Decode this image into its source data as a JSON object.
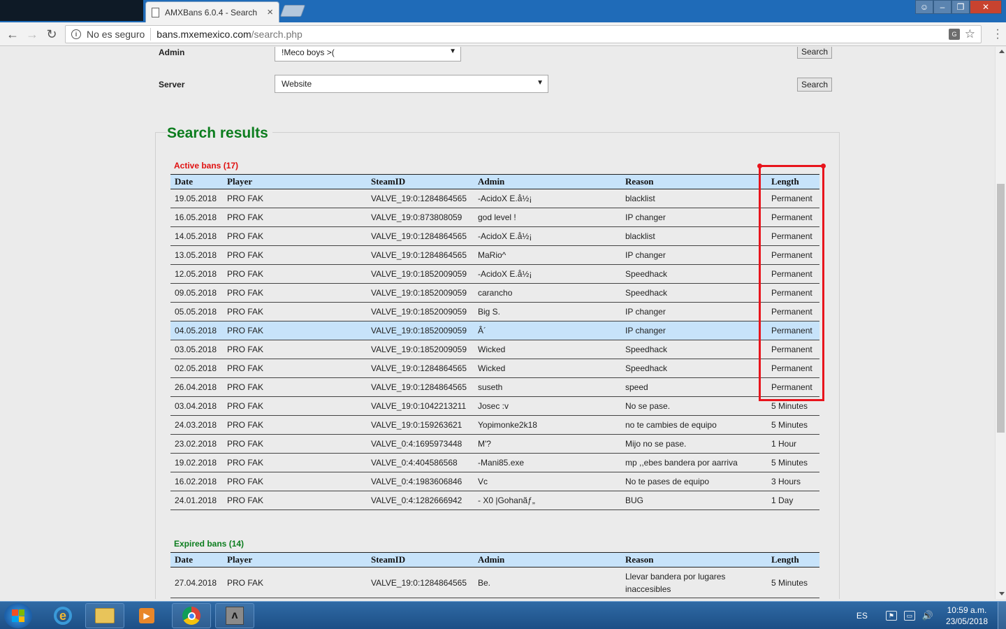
{
  "browser": {
    "tab_title": "AMXBans 6.0.4 - Search",
    "tab_close": "×",
    "security_label": "No es seguro",
    "url_host": "bans.mxemexico.com",
    "url_path": "/search.php"
  },
  "form": {
    "admin_label": "Admin",
    "admin_value": "!Meco boys >(",
    "server_label": "Server",
    "server_value": "Website",
    "search_button_label": "Search"
  },
  "results": {
    "heading": "Search results",
    "active_title": "Active bans (17)",
    "expired_title": "Expired bans (14)",
    "columns": [
      "Date",
      "Player",
      "SteamID",
      "Admin",
      "Reason",
      "Length"
    ],
    "active_rows": [
      [
        "19.05.2018",
        "PRO FAK",
        "VALVE_19:0:1284864565",
        "-AcidoX E.å½¡",
        "blacklist",
        "Permanent"
      ],
      [
        "16.05.2018",
        "PRO FAK",
        "VALVE_19:0:873808059",
        "god level !",
        "IP changer",
        "Permanent"
      ],
      [
        "14.05.2018",
        "PRO FAK",
        "VALVE_19:0:1284864565",
        "-AcidoX E.å½¡",
        "blacklist",
        "Permanent"
      ],
      [
        "13.05.2018",
        "PRO FAK",
        "VALVE_19:0:1284864565",
        "MaRio^",
        "IP changer",
        "Permanent"
      ],
      [
        "12.05.2018",
        "PRO FAK",
        "VALVE_19:0:1852009059",
        "-AcidoX E.å½¡",
        "Speedhack",
        "Permanent"
      ],
      [
        "09.05.2018",
        "PRO FAK",
        "VALVE_19:0:1852009059",
        "carancho",
        "Speedhack",
        "Permanent"
      ],
      [
        "05.05.2018",
        "PRO FAK",
        "VALVE_19:0:1852009059",
        "Big S.",
        "IP changer",
        "Permanent"
      ],
      [
        "04.05.2018",
        "PRO FAK",
        "VALVE_19:0:1852009059",
        "Â´",
        "IP changer",
        "Permanent"
      ],
      [
        "03.05.2018",
        "PRO FAK",
        "VALVE_19:0:1852009059",
        "Wicked",
        "Speedhack",
        "Permanent"
      ],
      [
        "02.05.2018",
        "PRO FAK",
        "VALVE_19:0:1284864565",
        "Wicked",
        "Speedhack",
        "Permanent"
      ],
      [
        "26.04.2018",
        "PRO FAK",
        "VALVE_19:0:1284864565",
        "suseth",
        "speed",
        "Permanent"
      ],
      [
        "03.04.2018",
        "PRO FAK",
        "VALVE_19:0:1042213211",
        "Josec :v",
        "No se pase.",
        "5 Minutes"
      ],
      [
        "24.03.2018",
        "PRO FAK",
        "VALVE_19:0:159263621",
        "Yopimonke2k18",
        "no te cambies de equipo",
        "5 Minutes"
      ],
      [
        "23.02.2018",
        "PRO FAK",
        "VALVE_0:4:1695973448",
        "M'?",
        "Mijo no se pase.",
        "1 Hour"
      ],
      [
        "19.02.2018",
        "PRO FAK",
        "VALVE_0:4:404586568",
        "-Mani85.exe",
        "mp ,,ebes bandera por aarriva",
        "5 Minutes"
      ],
      [
        "16.02.2018",
        "PRO FAK",
        "VALVE_0:4:1983606846",
        "Vc",
        "No te pases de equipo",
        "3 Hours"
      ],
      [
        "24.01.2018",
        "PRO FAK",
        "VALVE_0:4:1282666942",
        "- X0 |Gohanãƒ„",
        "BUG",
        "1 Day"
      ]
    ],
    "highlighted_active_row": 7,
    "expired_rows": [
      [
        "27.04.2018",
        "PRO FAK",
        "VALVE_19:0:1284864565",
        "Be.",
        "Llevar bandera por lugares inaccesibles",
        "5 Minutes"
      ]
    ]
  },
  "taskbar": {
    "lang": "ES",
    "time": "10:59 a.m.",
    "date": "23/05/2018"
  },
  "colors": {
    "heading_green": "#0c7d1e",
    "active_red": "#e01010",
    "header_blue": "#c7e3fa",
    "annotation_red": "#e8141c"
  }
}
